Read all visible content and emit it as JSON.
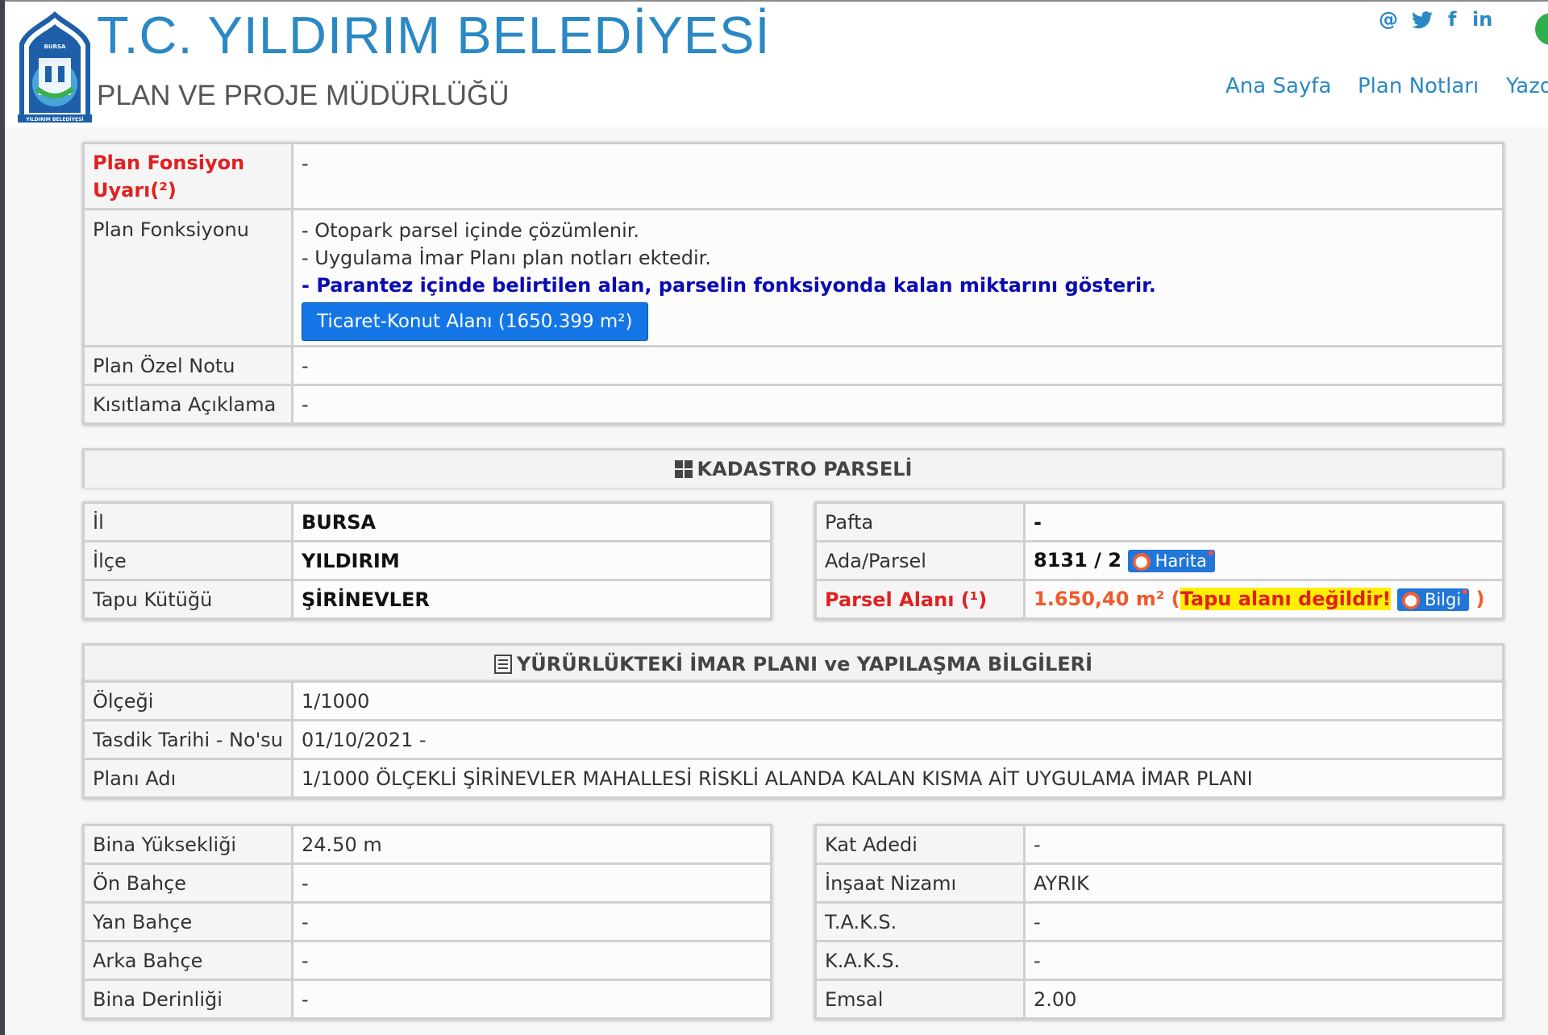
{
  "header": {
    "title": "T.C. YILDIRIM BELEDİYESİ",
    "subtitle": "PLAN VE PROJE MÜDÜRLÜĞÜ",
    "logo_text_top": "BURSA",
    "logo_text_bottom": "YILDIRIM BELEDİYESİ",
    "social": [
      "@",
      "twitter",
      "f",
      "in"
    ],
    "nav": [
      "Ana Sayfa",
      "Plan Notları",
      "Yazd"
    ]
  },
  "plan_info": {
    "warning_label": "Plan Fonsiyon Uyarı(²)",
    "warning_value": "-",
    "function_label": "Plan Fonksiyonu",
    "function_lines": [
      "- Otopark parsel içinde çözümlenir.",
      "- Uygulama İmar Planı plan notları ektedir.",
      "- Parantez içinde belirtilen alan, parselin fonksiyonda kalan miktarını gösterir."
    ],
    "function_button": "Ticaret-Konut Alanı (1650.399 m²)",
    "special_note_label": "Plan Özel Notu",
    "special_note_value": "-",
    "restriction_label": "Kısıtlama Açıklama",
    "restriction_value": "-"
  },
  "cadastre": {
    "header": "KADASTRO PARSELİ",
    "il_label": "İl",
    "il_value": "BURSA",
    "ilce_label": "İlçe",
    "ilce_value": "YILDIRIM",
    "tapu_label": "Tapu Kütüğü",
    "tapu_value": "ŞİRİNEVLER",
    "pafta_label": "Pafta",
    "pafta_value": "-",
    "ada_label": "Ada/Parsel",
    "ada_value": "8131 / 2",
    "harita_button": "Harita",
    "alan_label": "Parsel Alanı (¹)",
    "alan_value": "1.650,40 m²",
    "alan_open": " (",
    "alan_warning": "Tapu alanı değildir!",
    "bilgi_button": "Bilgi",
    "alan_close": " )"
  },
  "zoning": {
    "header": "YÜRÜRLÜKTEKİ İMAR PLANI ve YAPILAŞMA BİLGİLERİ",
    "rows": [
      {
        "label": "Ölçeği",
        "value": "1/1000"
      },
      {
        "label": "Tasdik Tarihi - No'su",
        "value": "01/10/2021 -"
      },
      {
        "label": "Planı Adı",
        "value": "1/1000 ÖLÇEKLİ ŞİRİNEVLER MAHALLESİ RİSKLİ ALANDA KALAN KISMA AİT UYGULAMA İMAR PLANI"
      }
    ]
  },
  "building_left": [
    {
      "label": "Bina Yüksekliği",
      "value": "24.50 m"
    },
    {
      "label": "Ön Bahçe",
      "value": "-"
    },
    {
      "label": "Yan Bahçe",
      "value": "-"
    },
    {
      "label": "Arka Bahçe",
      "value": "-"
    },
    {
      "label": "Bina Derinliği",
      "value": "-"
    }
  ],
  "building_right": [
    {
      "label": "Kat Adedi",
      "value": "-"
    },
    {
      "label": "İnşaat Nizamı",
      "value": "AYRIK"
    },
    {
      "label": "T.A.K.S.",
      "value": "-"
    },
    {
      "label": "K.A.K.S.",
      "value": "-"
    },
    {
      "label": "Emsal",
      "value": "2.00"
    }
  ],
  "colors": {
    "brand": "#2a88c4",
    "warning": "#e02020",
    "button": "#1476e6"
  }
}
